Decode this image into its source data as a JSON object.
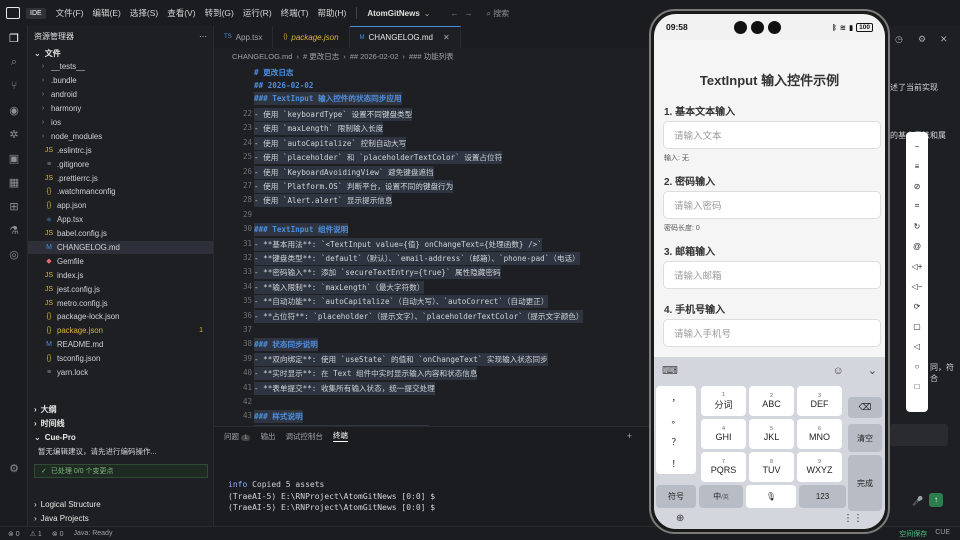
{
  "titlebar": {
    "ide": "IDE",
    "menu": [
      "文件(F)",
      "编辑(E)",
      "选择(S)",
      "查看(V)",
      "转到(G)",
      "运行(R)",
      "终端(T)",
      "帮助(H)"
    ],
    "project": "AtomGitNews",
    "search": "搜索"
  },
  "sidebar": {
    "header": "资源管理器",
    "section": "文件",
    "items": [
      {
        "name": "__tests__",
        "type": "folder"
      },
      {
        "name": ".bundle",
        "type": "folder"
      },
      {
        "name": "android",
        "type": "folder"
      },
      {
        "name": "harmony",
        "type": "folder"
      },
      {
        "name": "ios",
        "type": "folder"
      },
      {
        "name": "node_modules",
        "type": "folder"
      },
      {
        "name": ".eslintrc.js",
        "type": "js"
      },
      {
        "name": ".gitignore",
        "type": "file"
      },
      {
        "name": ".prettierrc.js",
        "type": "js"
      },
      {
        "name": ".watchmanconfig",
        "type": "json"
      },
      {
        "name": "app.json",
        "type": "json"
      },
      {
        "name": "App.tsx",
        "type": "ts"
      },
      {
        "name": "babel.config.js",
        "type": "js"
      },
      {
        "name": "CHANGELOG.md",
        "type": "md"
      },
      {
        "name": "Gemfile",
        "type": "gem"
      },
      {
        "name": "index.js",
        "type": "js"
      },
      {
        "name": "jest.config.js",
        "type": "js"
      },
      {
        "name": "metro.config.js",
        "type": "js"
      },
      {
        "name": "package-lock.json",
        "type": "json"
      },
      {
        "name": "package.json",
        "type": "json"
      },
      {
        "name": "README.md",
        "type": "md"
      },
      {
        "name": "tsconfig.json",
        "type": "json"
      },
      {
        "name": "yarn.lock",
        "type": "file"
      }
    ],
    "modified_badge": "1",
    "outline": "大纲",
    "timeline": "时间线",
    "cue_title": "Cue-Pro",
    "cue_text": "暂无编辑建议，请先进行编码操作...",
    "processed": "已处理 0/0 个变更点",
    "logical_structure": "Logical Structure",
    "java_projects": "Java Projects"
  },
  "tabs": [
    {
      "label": "App.tsx",
      "icon": "TS"
    },
    {
      "label": "package.json",
      "icon": "{}"
    },
    {
      "label": "CHANGELOG.md",
      "icon": "M"
    }
  ],
  "breadcrumb": [
    "CHANGELOG.md",
    "# 更改日志",
    "## 2026-02-02",
    "### 功能列表"
  ],
  "editor": {
    "sticky": [
      "# 更改日志",
      "## 2026-02-02",
      "### TextInput 输入控件的状态同步应用"
    ],
    "lines": [
      {
        "n": "22",
        "text": "- 使用 `keyboardType` 设置不同键盘类型"
      },
      {
        "n": "23",
        "text": "- 使用 `maxLength` 限制输入长度"
      },
      {
        "n": "24",
        "text": "- 使用 `autoCapitalize` 控制自动大写"
      },
      {
        "n": "25",
        "text": "- 使用 `placeholder` 和 `placeholderTextColor` 设置占位符"
      },
      {
        "n": "26",
        "text": "- 使用 `KeyboardAvoidingView` 避免键盘遮挡"
      },
      {
        "n": "27",
        "text": "- 使用 `Platform.OS` 判断平台，设置不同的键盘行为"
      },
      {
        "n": "28",
        "text": "- 使用 `Alert.alert` 显示提示信息"
      },
      {
        "n": "29",
        "text": ""
      },
      {
        "n": "30",
        "text": "### TextInput 组件说明"
      },
      {
        "n": "31",
        "text": "- **基本用法**: `<TextInput value={值} onChangeText={处理函数} />`"
      },
      {
        "n": "32",
        "text": "- **键盘类型**: `default`（默认）、`email-address`（邮箱）、`phone-pad`（电话）"
      },
      {
        "n": "33",
        "text": "- **密码输入**: 添加 `secureTextEntry={true}` 属性隐藏密码"
      },
      {
        "n": "34",
        "text": "- **输入限制**: `maxLength`（最大字符数）"
      },
      {
        "n": "35",
        "text": "- **自动功能**: `autoCapitalize`（自动大写）、`autoCorrect`（自动更正）"
      },
      {
        "n": "36",
        "text": "- **占位符**: `placeholder`（提示文字）、`placeholderTextColor`（提示文字颜色）"
      },
      {
        "n": "37",
        "text": ""
      },
      {
        "n": "38",
        "text": "### 状态同步说明"
      },
      {
        "n": "39",
        "text": "- **双向绑定**: 使用 `useState` 的值和 `onChangeText` 实现输入状态同步"
      },
      {
        "n": "40",
        "text": "- **实时显示**: 在 Text 组件中实时显示输入内容和状态信息"
      },
      {
        "n": "41",
        "text": "- **表单提交**: 收集所有输入状态，统一提交处理"
      },
      {
        "n": "42",
        "text": ""
      },
      {
        "n": "43",
        "text": "### 样式说明"
      },
      {
        "n": "44",
        "text": "- 使用 `StyleSheet.create()` 创建样式对象"
      }
    ]
  },
  "panel": {
    "tabs": [
      "问题",
      "输出",
      "调试控制台",
      "终端"
    ],
    "problems_badge": "1",
    "terminal": [
      "info Copied 5 assets",
      "(TraeAI-5) E:\\RNProject\\AtomGitNews [0:0] $",
      "(TraeAI-5) E:\\RNProject\\AtomGitNews [0:0] $"
    ]
  },
  "rightpane": {
    "snippet1": "述了当前实现",
    "snippet2": "的基本用法和属",
    "snippet3": "同，符合"
  },
  "status": {
    "left": [
      "⊗ 0",
      "⚠ 1",
      "⊗ 0",
      "Java: Ready"
    ],
    "right": [
      "空间保存",
      "CUE"
    ]
  },
  "phone": {
    "time": "09:58",
    "battery": "100",
    "app_title": "TextInput 输入控件示例",
    "sections": [
      {
        "label": "1. 基本文本输入",
        "placeholder": "请输入文本",
        "hint": "输入: 无"
      },
      {
        "label": "2. 密码输入",
        "placeholder": "请输入密码",
        "hint": "密码长度: 0"
      },
      {
        "label": "3. 邮箱输入",
        "placeholder": "请输入邮箱",
        "hint": ""
      },
      {
        "label": "4. 手机号输入",
        "placeholder": "请输入手机号",
        "hint": ""
      }
    ],
    "keyboard": {
      "left": [
        "，",
        "。",
        "？",
        "！"
      ],
      "keys": [
        {
          "num": "1",
          "label": "分词"
        },
        {
          "num": "2",
          "label": "ABC"
        },
        {
          "num": "3",
          "label": "DEF"
        },
        {
          "num": "4",
          "label": "GHI"
        },
        {
          "num": "5",
          "label": "JKL"
        },
        {
          "num": "6",
          "label": "MNO"
        },
        {
          "num": "7",
          "label": "PQRS"
        },
        {
          "num": "8",
          "label": "TUV"
        },
        {
          "num": "9",
          "label": "WXYZ"
        }
      ],
      "delete": "⌫",
      "clear": "清空",
      "done": "完成",
      "symbol": "符号",
      "lang": "中",
      "lang_sub": "/英",
      "numkey": "123"
    }
  }
}
